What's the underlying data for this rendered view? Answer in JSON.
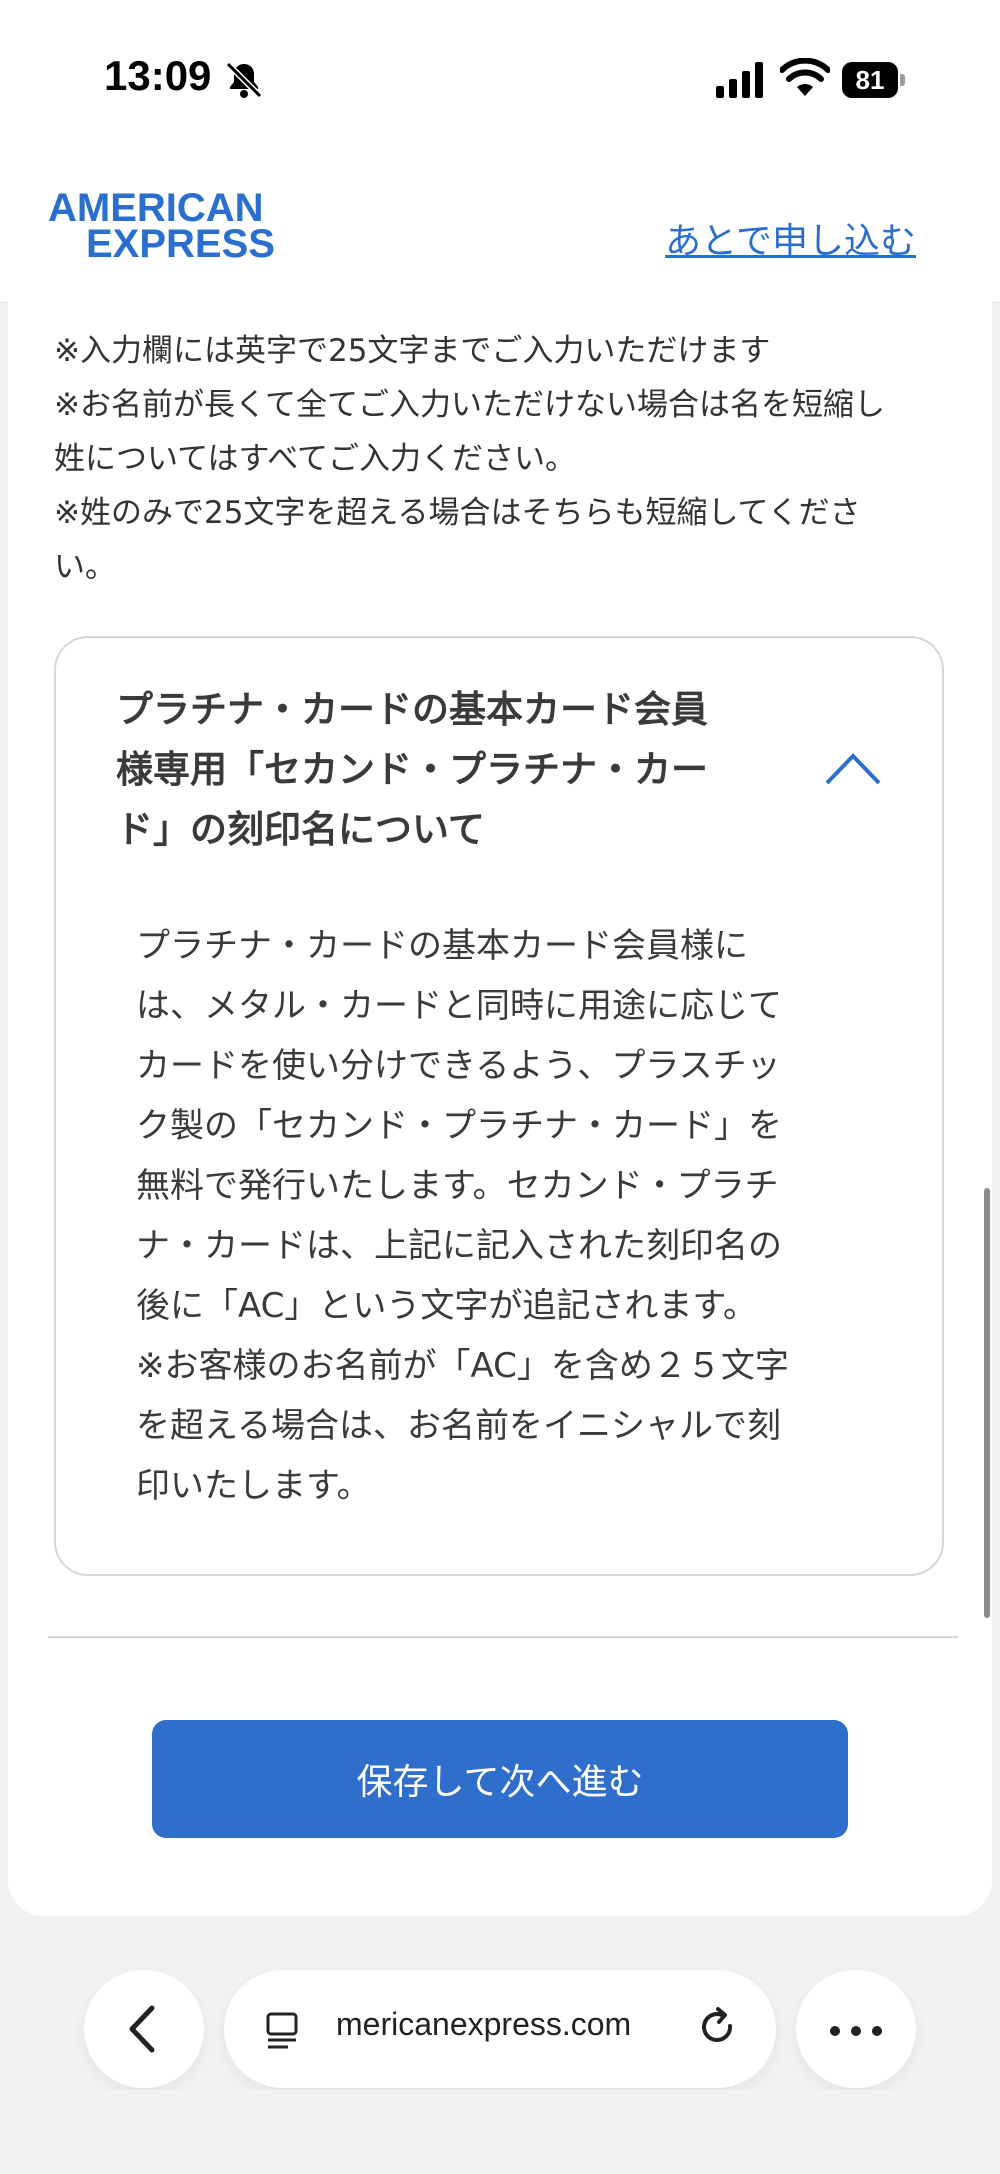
{
  "status_bar": {
    "time": "13:09",
    "battery": "81",
    "icons": [
      "bell-slash-icon",
      "signal-icon",
      "wifi-icon",
      "battery-icon"
    ]
  },
  "header": {
    "logo_line1": "AMERICAN",
    "logo_line2": "EXPRESS",
    "apply_later": "あとで申し込む",
    "brand_color": "#2b6fce"
  },
  "notes": [
    "※入力欄には英字で25文字までご入力いただけます",
    "※お名前が長くて全てご入力いただけない場合は名を短縮し",
    "姓についてはすべてご入力ください。",
    "※姓のみで25文字を超える場合はそちらも短縮してくださ",
    "い。"
  ],
  "accordion": {
    "title_lines": [
      "プラチナ・カードの基本カード会員",
      "様専用「セカンド・プラチナ・カー",
      "ド」の刻印名について"
    ],
    "expanded": true,
    "body_lines": [
      "プラチナ・カードの基本カード会員様に",
      "は、メタル・カードと同時に用途に応じて",
      "カードを使い分けできるよう、プラスチッ",
      "ク製の「セカンド・プラチナ・カード」を",
      "無料で発行いたします。セカンド・プラチ",
      "ナ・カードは、上記に記入された刻印名の",
      "後に「AC」という文字が追記されます。",
      "※お客様のお名前が「AC」を含め２５文字",
      "を超える場合は、お名前をイニシャルで刻",
      "印いたします。"
    ]
  },
  "actions": {
    "save_next": "保存して次へ進む",
    "button_color": "#2f6fcb"
  },
  "browser": {
    "url": "mericanexpress.com"
  }
}
